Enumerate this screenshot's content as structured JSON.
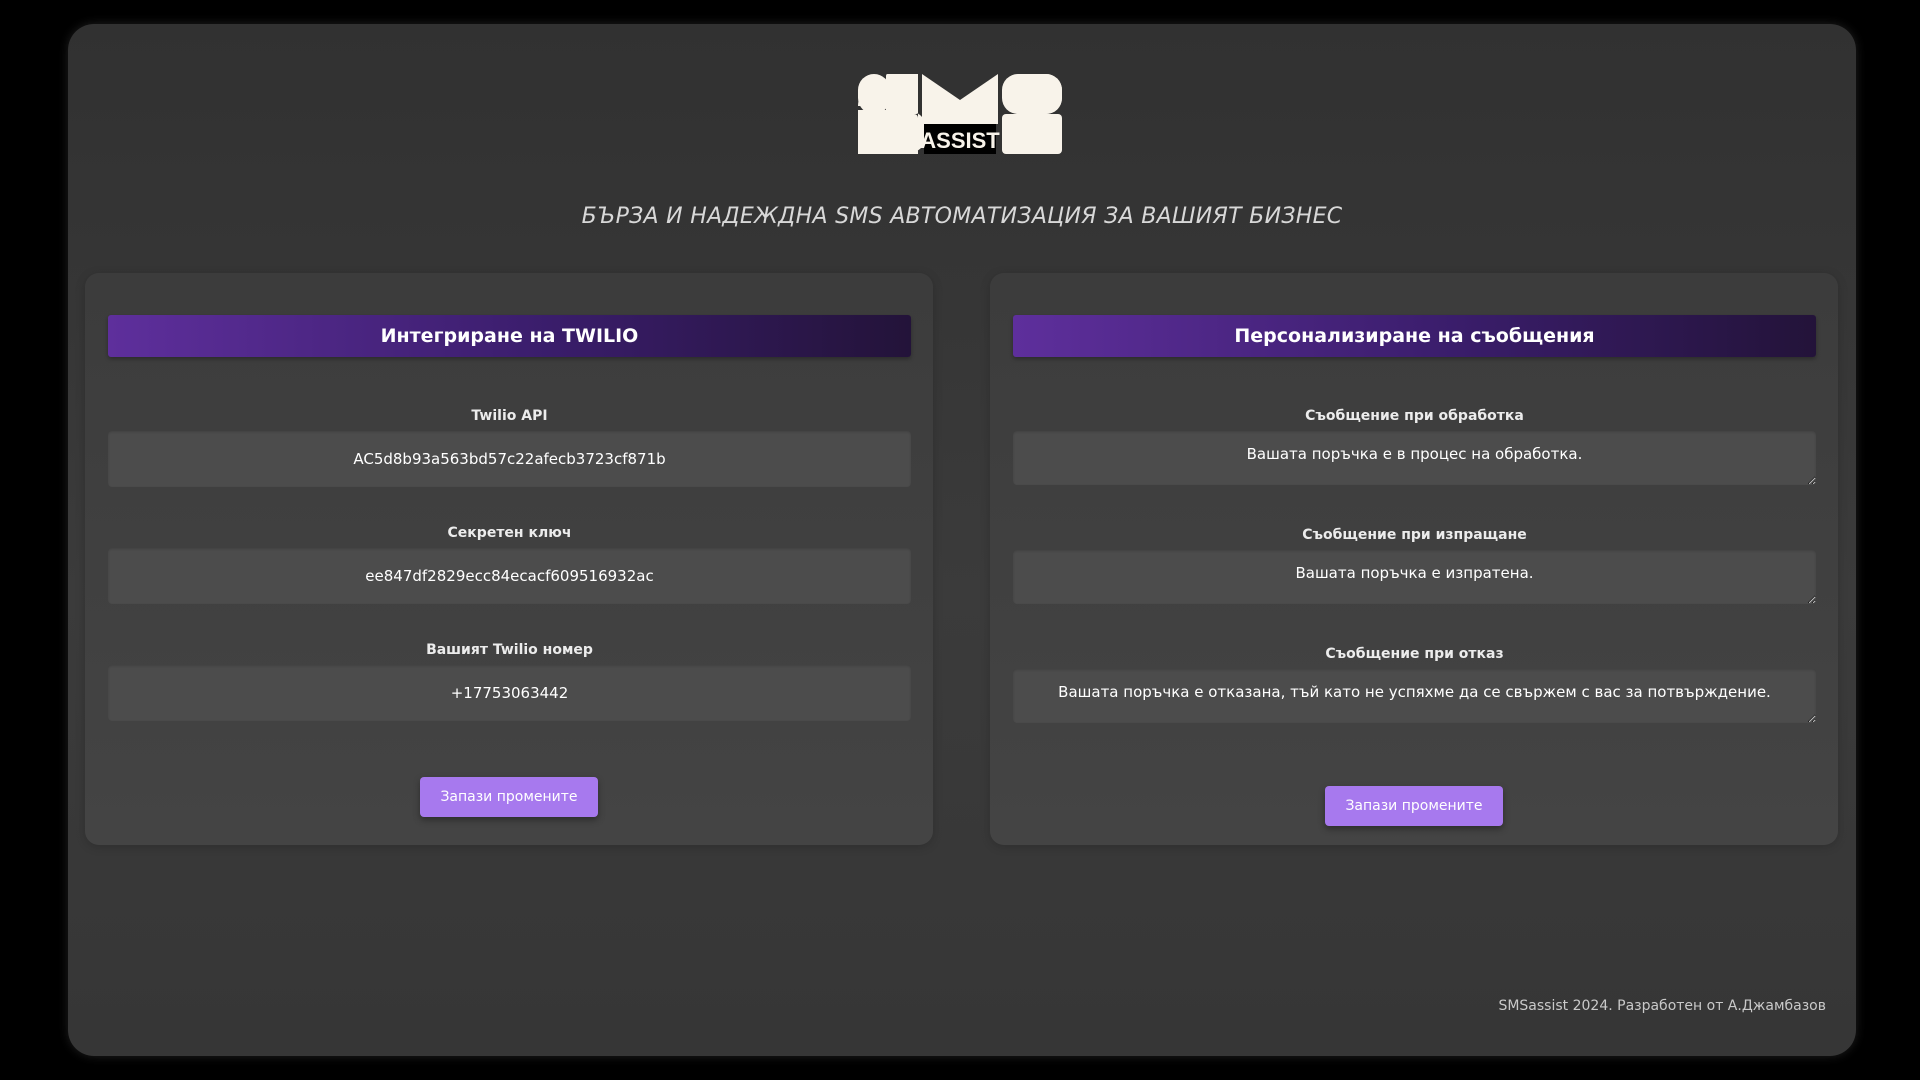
{
  "logo": {
    "text": "SMS",
    "subtext": "ASSIST",
    "color": "#f8f3ea"
  },
  "tagline": "БЪРЗА И НАДЕЖДНА SMS АВТОМАТИЗАЦИЯ ЗА ВАШИЯТ БИЗНЕС",
  "twilio": {
    "title": "Интегриране на TWILIO",
    "api_label": "Twilio API",
    "api_value": "AC5d8b93a563bd57c22afecb3723cf871b",
    "secret_label": "Секретен ключ",
    "secret_value": "ee847df2829ecc84ecacf609516932ac",
    "number_label": "Вашият Twilio номер",
    "number_value": "+17753063442",
    "save_label": "Запази промените"
  },
  "messages": {
    "title": "Персонализиране на съобщения",
    "processing_label": "Съобщение при обработка",
    "processing_value": "Вашата поръчка е в процес на обработка.",
    "shipping_label": "Съобщение при изпращане",
    "shipping_value": "Вашата поръчка е изпратена.",
    "reject_label": "Съобщение при отказ",
    "reject_value": "Вашата поръчка е отказана, тъй като не успяхме да се свържем с вас за потвърждение.",
    "save_label": "Запази промените"
  },
  "footer": "SMSassist 2024. Разработен от А.Джамбазов",
  "colors": {
    "accent": "#a779ee",
    "header_gradient_start": "#5e2f9c",
    "header_gradient_end": "#231339",
    "background": "#333333"
  }
}
